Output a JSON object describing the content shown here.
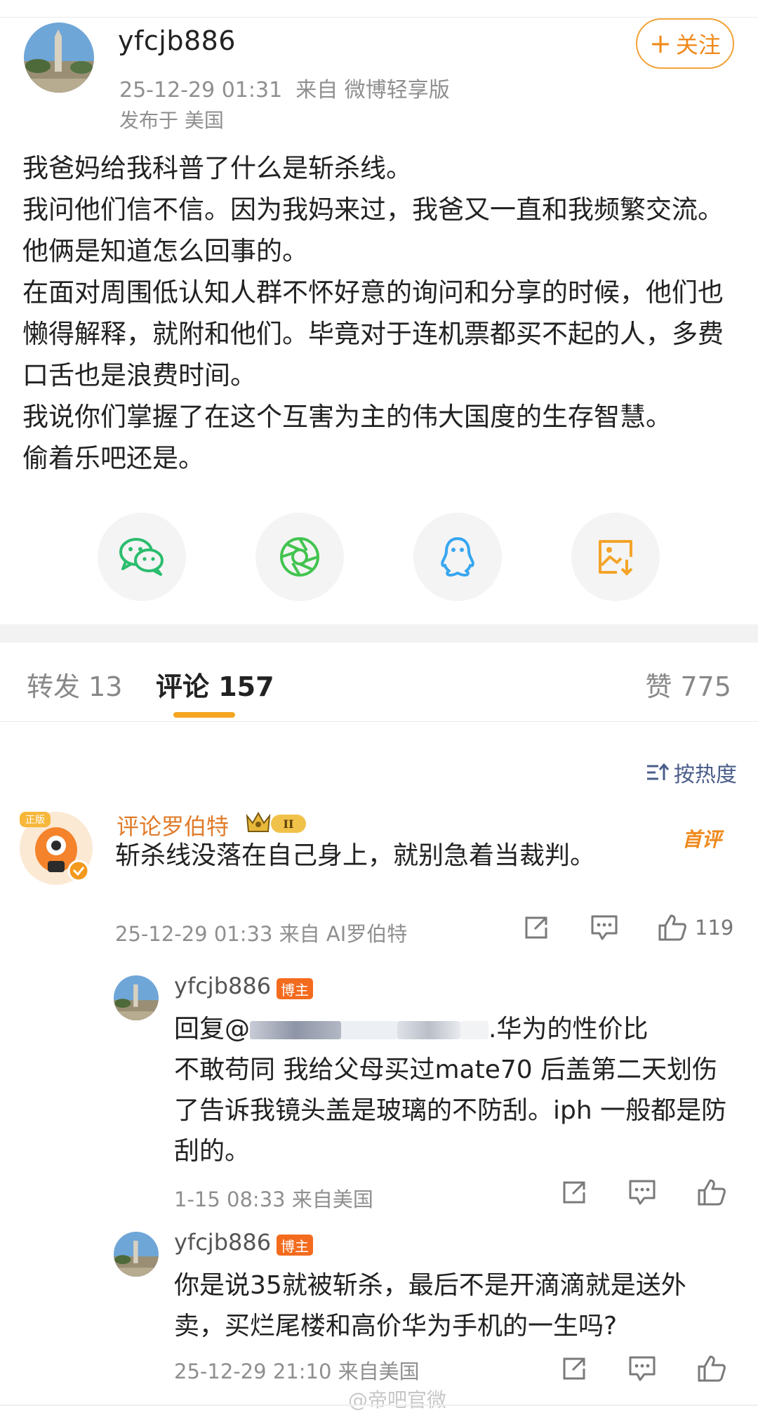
{
  "post": {
    "author": "yfcjb886",
    "time": "25-12-29 01:31",
    "source": "来自 微博轻享版",
    "location": "发布于 美国",
    "follow_label": "关注",
    "body": [
      "我爸妈给我科普了什么是斩杀线。",
      "我问他们信不信。因为我妈来过，我爸又一直和我频繁交流。他俩是知道怎么回事的。",
      "在面对周围低认知人群不怀好意的询问和分享的时候，他们也懒得解释，就附和他们。毕竟对于连机票都买不起的人，多费口舌也是浪费时间。",
      "我说你们掌握了在这个互害为主的伟大国度的生存智慧。",
      "偷着乐吧还是。"
    ]
  },
  "share_icons": [
    {
      "name": "wechat-icon",
      "color": "#2bbd6e"
    },
    {
      "name": "moments-icon",
      "color": "#42c44f"
    },
    {
      "name": "qq-icon",
      "color": "#36a6f0"
    },
    {
      "name": "save-image-icon",
      "color": "#f3a429"
    }
  ],
  "tabs": {
    "repost": "转发 13",
    "comment": "评论 157",
    "like": "赞 775"
  },
  "sort_label": "按热度",
  "comments": [
    {
      "name": "评论罗伯特",
      "badge_level": "II",
      "first_badge": "首评",
      "text": "斩杀线没落在自己身上，就别急着当裁判。",
      "meta": "25-12-29 01:33  来自 AI罗伯特",
      "likes": "119",
      "robot_badge": "正版"
    }
  ],
  "replies": [
    {
      "name": "yfcjb886",
      "owner_badge": "博主",
      "text_prefix": "回复@",
      "text_suffix": ".华为的性价比",
      "text_rest": "不敢苟同 我给父母买过mate70 后盖第二天划伤了告诉我镜头盖是玻璃的不防刮。iph 一般都是防刮的。",
      "meta": "1-15 08:33  来自美国"
    },
    {
      "name": "yfcjb886",
      "owner_badge": "博主",
      "text": "你是说35就被斩杀，最后不是开滴滴就是送外卖，买烂尾楼和高价华为手机的一生吗?",
      "meta": "25-12-29 21:10  来自美国"
    }
  ],
  "watermark": "@帝吧官微"
}
